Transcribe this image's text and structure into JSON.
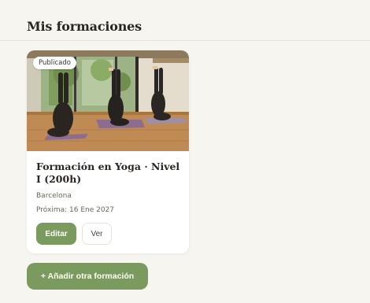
{
  "section": {
    "title": "Mis formaciones"
  },
  "card": {
    "status": "Publicado",
    "title": "Formación en Yoga · Nivel I (200h)",
    "location": "Barcelona",
    "next_date": "Próxima: 16 Ene 2027",
    "edit_label": "Editar",
    "view_label": "Ver"
  },
  "add_button": {
    "label": "+ Añadir otra formación"
  },
  "colors": {
    "accent": "#7b9a5e",
    "background": "#f7f5f0",
    "card": "#ffffff"
  }
}
